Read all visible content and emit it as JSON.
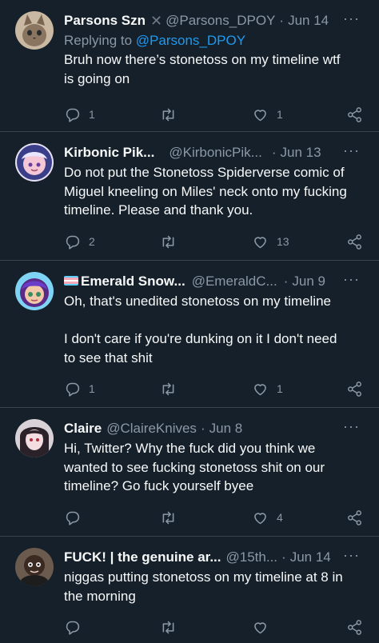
{
  "tweets": [
    {
      "name": "Parsons Szn",
      "handle": "@Parsons_DPOY",
      "date": "Jun 14",
      "replying_prefix": "Replying to",
      "replying_to": "@Parsons_DPOY",
      "text": "Bruh now there’s stonetoss on my timeline wtf\nis going on",
      "replies": "1",
      "retweets": "",
      "likes": "1"
    },
    {
      "name": "Kirbonic Pik...",
      "handle": "@KirbonicPik...",
      "date": "Jun 13",
      "text": "Do not put the Stonetoss Spiderverse comic of\nMiguel kneeling on Miles' neck onto my fucking\ntimeline. Please and thank you.",
      "replies": "2",
      "retweets": "",
      "likes": "13"
    },
    {
      "name": "Emerald Snow...",
      "handle": "@EmeraldC...",
      "date": "Jun 9",
      "text": "Oh, that's unedited stonetoss on my timeline\n\nI don't care if you're dunking on it I don't need\nto see that shit",
      "replies": "1",
      "retweets": "",
      "likes": "1"
    },
    {
      "name": "Claire",
      "handle": "@ClaireKnives",
      "date": "Jun 8",
      "text": "Hi, Twitter? Why the fuck did you think we\nwanted to see fucking stonetoss shit on our\ntimeline? Go fuck yourself byee",
      "replies": "",
      "retweets": "",
      "likes": "4"
    },
    {
      "name": "FUCK! | the genuine ar...",
      "handle": "@15th...",
      "date": "Jun 14",
      "text": "niggas putting stonetoss on my timeline at 8 in\nthe morning",
      "replies": "",
      "retweets": "",
      "likes": ""
    }
  ],
  "ui": {
    "more_glyph": "···",
    "dot": "·"
  },
  "colors": {
    "background": "#15202b",
    "divider": "#38444d",
    "muted": "#8b98a5",
    "link": "#1d9bf0",
    "text": "#f7f9f9"
  },
  "icons": [
    "reply-icon",
    "retweet-icon",
    "like-icon",
    "share-icon",
    "more-icon",
    "trans-flag-icon",
    "x-logo-icon"
  ]
}
